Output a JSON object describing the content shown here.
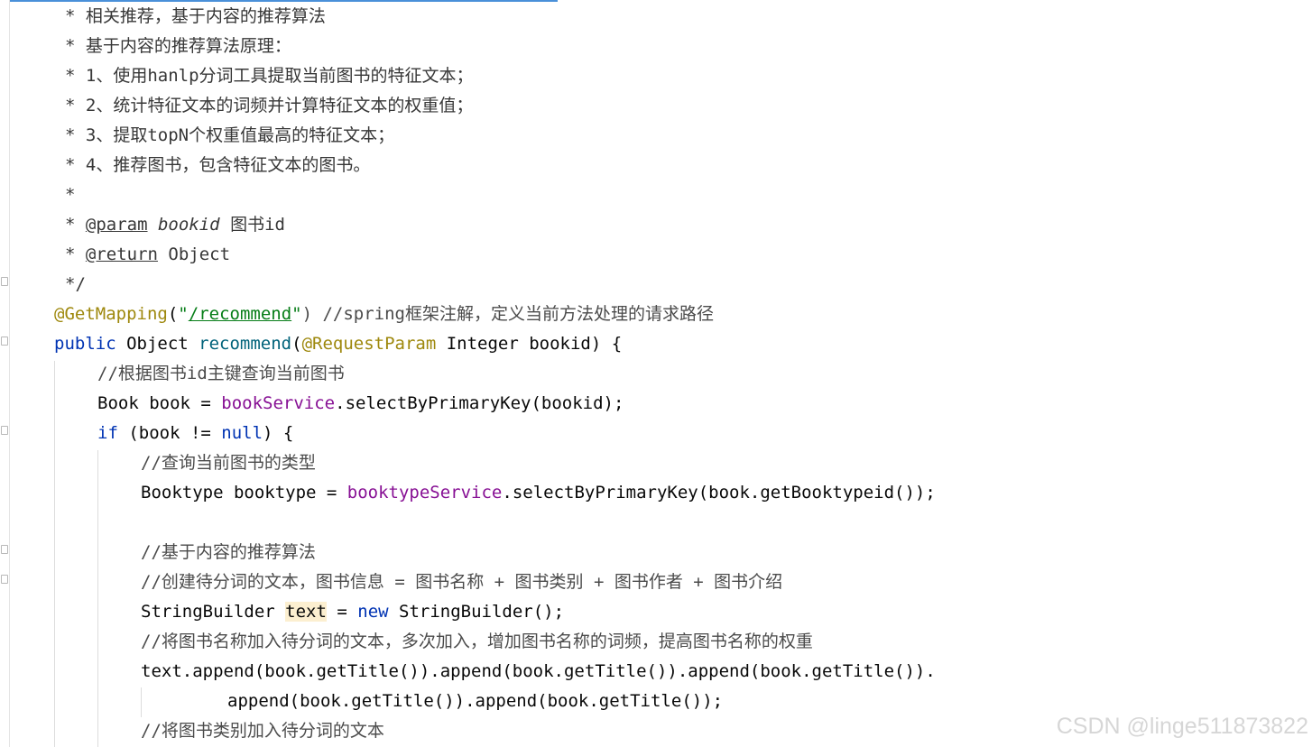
{
  "lines": [
    {
      "indent": 72,
      "segments": [
        {
          "t": "* 相关推荐，基于内容的推荐算法",
          "c": "doc"
        }
      ]
    },
    {
      "indent": 72,
      "segments": [
        {
          "t": "* 基于内容的推荐算法原理：",
          "c": "doc"
        }
      ]
    },
    {
      "indent": 72,
      "segments": [
        {
          "t": "* 1、使用hanlp分词工具提取当前图书的特征文本；",
          "c": "doc"
        }
      ]
    },
    {
      "indent": 72,
      "segments": [
        {
          "t": "* 2、统计特征文本的词频并计算特征文本的权重值；",
          "c": "doc"
        }
      ]
    },
    {
      "indent": 72,
      "segments": [
        {
          "t": "* 3、提取topN个权重值最高的特征文本；",
          "c": "doc"
        }
      ]
    },
    {
      "indent": 72,
      "segments": [
        {
          "t": "* 4、推荐图书，包含特征文本的图书。",
          "c": "doc"
        }
      ]
    },
    {
      "indent": 72,
      "segments": [
        {
          "t": "*",
          "c": "doc"
        }
      ]
    },
    {
      "indent": 72,
      "segments": [
        {
          "t": "* ",
          "c": "doc"
        },
        {
          "t": "@param",
          "c": "doctag"
        },
        {
          "t": " ",
          "c": "doc"
        },
        {
          "t": "bookid",
          "c": "docparam"
        },
        {
          "t": " 图书id",
          "c": "doc"
        }
      ]
    },
    {
      "indent": 72,
      "segments": [
        {
          "t": "* ",
          "c": "doc"
        },
        {
          "t": "@return",
          "c": "doctag"
        },
        {
          "t": " Object",
          "c": "doc"
        }
      ]
    },
    {
      "indent": 72,
      "segments": [
        {
          "t": "*/",
          "c": "doc"
        }
      ]
    },
    {
      "indent": 60,
      "segments": [
        {
          "t": "@GetMapping",
          "c": "ann"
        },
        {
          "t": "(",
          "c": "plain"
        },
        {
          "t": "\"",
          "c": "str"
        },
        {
          "t": "/recommend",
          "c": "strlink"
        },
        {
          "t": "\"",
          "c": "str"
        },
        {
          "t": ") //spring框架注解，定义当前方法处理的请求路径",
          "c": "cmt"
        }
      ]
    },
    {
      "indent": 60,
      "segments": [
        {
          "t": "public",
          "c": "kw"
        },
        {
          "t": " Object ",
          "c": "plain"
        },
        {
          "t": "recommend",
          "c": "mth"
        },
        {
          "t": "(",
          "c": "plain"
        },
        {
          "t": "@RequestParam",
          "c": "ann"
        },
        {
          "t": " Integer bookid) {",
          "c": "plain"
        }
      ]
    },
    {
      "indent": 108,
      "segments": [
        {
          "t": "//根据图书id主键查询当前图书",
          "c": "cmt"
        }
      ]
    },
    {
      "indent": 108,
      "segments": [
        {
          "t": "Book book = ",
          "c": "plain"
        },
        {
          "t": "bookService",
          "c": "field"
        },
        {
          "t": ".selectByPrimaryKey(bookid);",
          "c": "plain"
        }
      ]
    },
    {
      "indent": 108,
      "segments": [
        {
          "t": "if",
          "c": "kw"
        },
        {
          "t": " (book != ",
          "c": "plain"
        },
        {
          "t": "null",
          "c": "kw"
        },
        {
          "t": ") {",
          "c": "plain"
        }
      ]
    },
    {
      "indent": 156,
      "segments": [
        {
          "t": "//查询当前图书的类型",
          "c": "cmt"
        }
      ]
    },
    {
      "indent": 156,
      "segments": [
        {
          "t": "Booktype booktype = ",
          "c": "plain"
        },
        {
          "t": "booktypeService",
          "c": "field"
        },
        {
          "t": ".selectByPrimaryKey(book.getBooktypeid());",
          "c": "plain"
        }
      ]
    },
    {
      "indent": 156,
      "segments": []
    },
    {
      "indent": 156,
      "segments": [
        {
          "t": "//基于内容的推荐算法",
          "c": "cmt"
        }
      ]
    },
    {
      "indent": 156,
      "segments": [
        {
          "t": "//创建待分词的文本，图书信息 = 图书名称 + 图书类别 + 图书作者 + 图书介绍",
          "c": "cmt"
        }
      ]
    },
    {
      "indent": 156,
      "segments": [
        {
          "t": "StringBuilder ",
          "c": "plain"
        },
        {
          "t": "text",
          "c": "hl"
        },
        {
          "t": " = ",
          "c": "plain"
        },
        {
          "t": "new",
          "c": "kw"
        },
        {
          "t": " StringBuilder();",
          "c": "plain"
        }
      ]
    },
    {
      "indent": 156,
      "segments": [
        {
          "t": "//将图书名称加入待分词的文本，多次加入，增加图书名称的词频，提高图书名称的权重",
          "c": "cmt"
        }
      ]
    },
    {
      "indent": 156,
      "segments": [
        {
          "t": "text.append(book.getTitle()).append(book.getTitle()).append(book.getTitle()).",
          "c": "plain"
        }
      ]
    },
    {
      "indent": 252,
      "segments": [
        {
          "t": "append(book.getTitle()).append(book.getTitle());",
          "c": "plain"
        }
      ]
    },
    {
      "indent": 156,
      "segments": [
        {
          "t": "//将图书类别加入待分词的文本",
          "c": "cmt"
        }
      ]
    }
  ],
  "watermark": "CSDN @linge511873822"
}
